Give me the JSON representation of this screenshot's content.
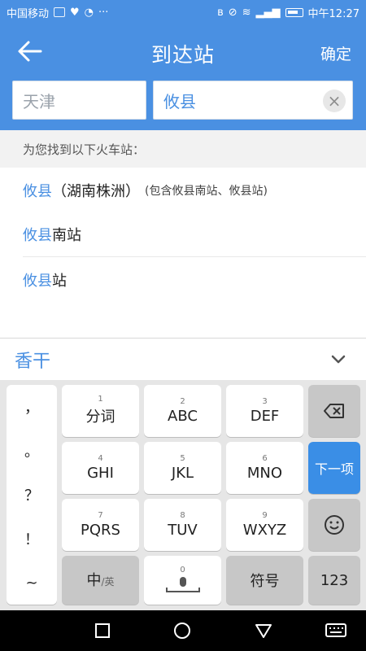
{
  "statusbar": {
    "carrier": "中国移动",
    "hd": "HD",
    "time": "中午12:27"
  },
  "header": {
    "title": "到达站",
    "confirm": "确定"
  },
  "search": {
    "from_value": "天津",
    "to_value": "攸县"
  },
  "hint": "为您找到以下火车站：",
  "results": [
    {
      "hl": "攸县",
      "rest": "（湖南株洲）",
      "note": "(包含攸县南站、攸县站)"
    },
    {
      "hl": "攸县",
      "rest": "南站",
      "note": ""
    },
    {
      "hl": "攸县",
      "rest": "站",
      "note": ""
    }
  ],
  "candidate": "香干",
  "keyboard": {
    "punct": [
      "，",
      "。",
      "？",
      "！",
      "~"
    ],
    "keys": [
      {
        "num": "1",
        "label": "分词"
      },
      {
        "num": "2",
        "label": "ABC"
      },
      {
        "num": "3",
        "label": "DEF"
      },
      {
        "num": "4",
        "label": "GHI"
      },
      {
        "num": "5",
        "label": "JKL"
      },
      {
        "num": "6",
        "label": "MNO"
      },
      {
        "num": "7",
        "label": "PQRS"
      },
      {
        "num": "8",
        "label": "TUV"
      },
      {
        "num": "9",
        "label": "WXYZ"
      },
      {
        "num": "0",
        "label": ""
      }
    ],
    "next_item": "下一项",
    "lang_main": "中",
    "lang_alt": "/英",
    "symbols": "符号",
    "numeric": "123"
  },
  "colors": {
    "accent": "#4a90e2",
    "key_blue": "#3a8ee6"
  }
}
